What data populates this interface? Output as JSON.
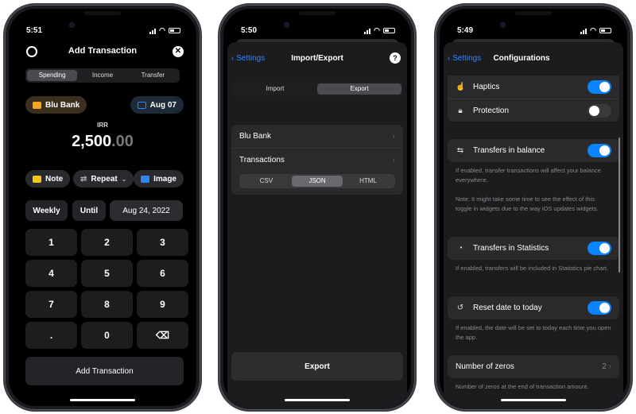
{
  "phone1": {
    "time": "5:51",
    "title": "Add Transaction",
    "tabs": [
      "Spending",
      "Income",
      "Transfer"
    ],
    "active_tab": "Spending",
    "account": "Blu Bank",
    "date": "Aug 07",
    "currency": "IRR",
    "amount_int": "2,500",
    "amount_dec": ".00",
    "note_label": "Note",
    "repeat_label": "Repeat",
    "image_label": "Image",
    "frequency": "Weekly",
    "until_label": "Until",
    "until_date": "Aug 24, 2022",
    "keys": [
      "1",
      "2",
      "3",
      "4",
      "5",
      "6",
      "7",
      "8",
      "9",
      ".",
      "0"
    ],
    "submit_label": "Add Transaction",
    "colors": {
      "account_icon": "#f5a623",
      "date_icon": "#2f87f5",
      "note_icon": "#f5c518",
      "image_icon": "#2f87f5"
    }
  },
  "phone2": {
    "time": "5:50",
    "back_label": "Settings",
    "title": "Import/Export",
    "tabs": [
      "Import",
      "Export"
    ],
    "active_tab": "Export",
    "rows": [
      "Blu Bank",
      "Transactions"
    ],
    "formats": [
      "CSV",
      "JSON",
      "HTML"
    ],
    "active_format": "JSON",
    "export_label": "Export"
  },
  "phone3": {
    "time": "5:49",
    "back_label": "Settings",
    "title": "Configurations",
    "haptics": {
      "label": "Haptics",
      "on": true
    },
    "protection": {
      "label": "Protection",
      "on": false
    },
    "transfers_balance": {
      "label": "Transfers in balance",
      "on": true,
      "desc1": "If enabled, transfer transactions will affect your balance everywhere.",
      "desc2": "Note: It might take some time to see the effect of this toggle in widgets due to the way iOS updates widgets."
    },
    "transfers_stats": {
      "label": "Transfers in Statistics",
      "on": true,
      "desc": "If enabled, transfers will be included in Statistics pie chart."
    },
    "reset_date": {
      "label": "Reset date to today",
      "on": true,
      "desc": "If enabled, the date will be set to today each time you open the app."
    },
    "zeros": {
      "label": "Number of zeros",
      "value": "2",
      "desc": "Number of zeros at the end of transaction amount."
    },
    "accent": "#0a84ff"
  }
}
